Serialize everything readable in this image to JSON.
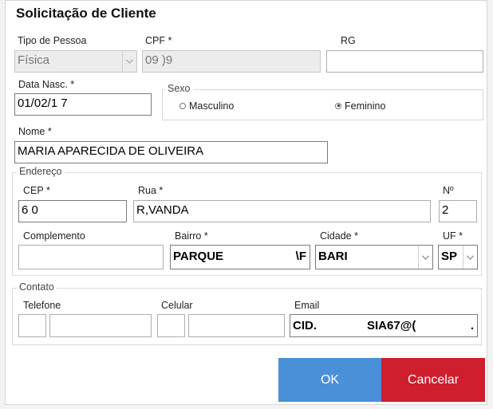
{
  "dialog": {
    "title": "Solicitação de Cliente"
  },
  "pessoa": {
    "tipo_label": "Tipo de Pessoa",
    "tipo_value": "Física",
    "cpf_label": "CPF *",
    "cpf_value": "09              )9",
    "rg_label": "RG",
    "rg_value": ""
  },
  "nascimento": {
    "label": "Data Nasc. *",
    "value": "01/02/1   7"
  },
  "sexo": {
    "legend": "Sexo",
    "masculino_label": "Masculino",
    "feminino_label": "Feminino",
    "selected": "Feminino"
  },
  "nome": {
    "label": "Nome *",
    "value": "MARIA APARECIDA DE OLIVEIRA"
  },
  "endereco": {
    "legend": "Endereço",
    "cep_label": "CEP *",
    "cep_value": "6          0",
    "rua_label": "Rua *",
    "rua_value": "R,VANDA",
    "numero_label": "Nº",
    "numero_value": "2",
    "complemento_label": "Complemento",
    "complemento_value": "",
    "bairro_label": "Bairro *",
    "bairro_value": "PARQUE",
    "bairro_tail": "\\F",
    "cidade_label": "Cidade *",
    "cidade_value": "BARI",
    "uf_label": "UF *",
    "uf_value": "SP"
  },
  "contato": {
    "legend": "Contato",
    "telefone_label": "Telefone",
    "celular_label": "Celular",
    "email_label": "Email",
    "email_value": "CID.",
    "email_tail": "SIA67@(",
    "email_end": "."
  },
  "buttons": {
    "ok_label": "OK",
    "cancel_label": "Cancelar"
  },
  "colors": {
    "ok": "#4a90d9",
    "cancel": "#cf1e2e"
  }
}
